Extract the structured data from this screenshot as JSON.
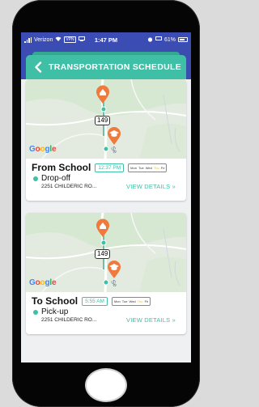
{
  "status_bar": {
    "carrier": "Verizon",
    "vpn": "VPN",
    "time": "1:47 PM",
    "battery": "61%"
  },
  "header": {
    "title": "TRANSPORTATION SCHEDULE"
  },
  "map": {
    "route_label": "149",
    "road_label": "Se",
    "logo": "Google"
  },
  "trips": [
    {
      "title": "From School",
      "time": "12:37 PM",
      "days": [
        "Mon",
        "Tue",
        "Wed",
        "Thu",
        "Fri"
      ],
      "type": "Drop-off",
      "address": "2251 CHILDERIC RO...",
      "action": "VIEW DETAILS »"
    },
    {
      "title": "To School",
      "time": "5:55 AM",
      "days": [
        "Mon",
        "Tue",
        "Wed",
        "Thu",
        "Fri"
      ],
      "type": "Pick-up",
      "address": "2251 CHILDERIC RO...",
      "action": "VIEW DETAILS »"
    }
  ],
  "colors": {
    "accent": "#3fbfa5",
    "status_bar": "#3b4db5",
    "today": "#f2b632",
    "marker": "#ef7a3c"
  }
}
